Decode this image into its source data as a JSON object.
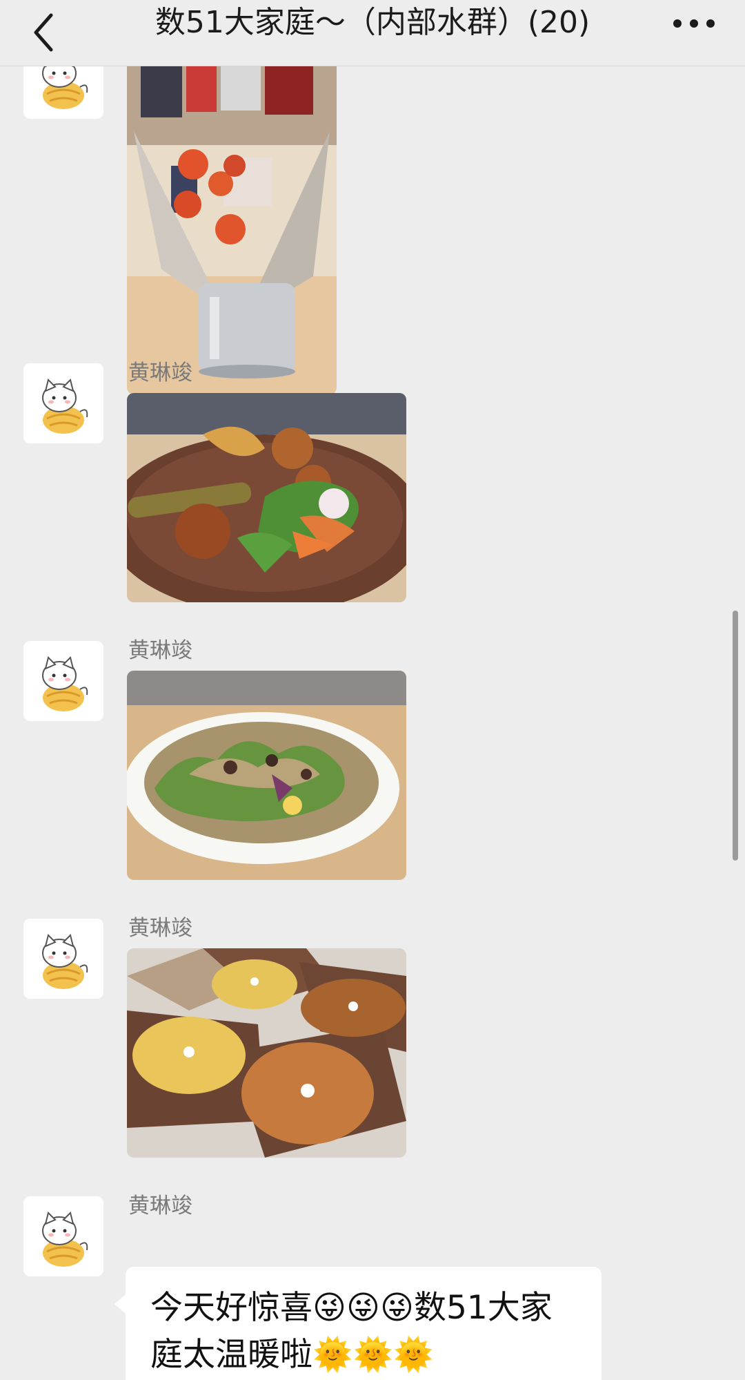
{
  "header": {
    "title": "数51大家庭～（内部水群）(20)",
    "back_icon": "chevron-left-icon",
    "more_icon": "more-dots-icon"
  },
  "messages": [
    {
      "type": "image",
      "sender": "",
      "image_desc": "flower-snack-bouquet-photo"
    },
    {
      "type": "image",
      "sender": "黄琳竣",
      "image_desc": "fried-platter-salad-photo"
    },
    {
      "type": "image",
      "sender": "黄琳竣",
      "image_desc": "salad-bowl-photo"
    },
    {
      "type": "image",
      "sender": "黄琳竣",
      "image_desc": "pizza-boxes-photo"
    },
    {
      "type": "text",
      "sender": "黄琳竣",
      "text": "今天好惊喜😜😜😜数51大家庭太温暖啦🌞🌞🌞"
    }
  ],
  "colors": {
    "background": "#ededed",
    "bubble": "#ffffff",
    "sender_name": "#7a7a7a"
  }
}
